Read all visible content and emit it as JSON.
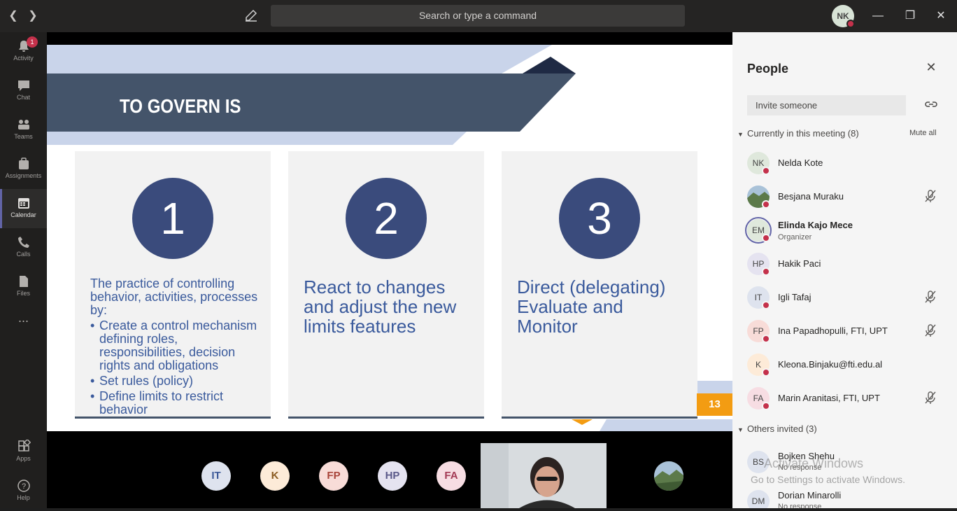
{
  "titlebar": {
    "search_placeholder": "Search or type a command",
    "me_initials": "NK"
  },
  "rail": {
    "activity_badge": "1",
    "items": [
      {
        "label": "Activity",
        "icon": "bell-icon"
      },
      {
        "label": "Chat",
        "icon": "chat-icon"
      },
      {
        "label": "Teams",
        "icon": "teams-icon"
      },
      {
        "label": "Assignments",
        "icon": "assignments-icon"
      },
      {
        "label": "Calendar",
        "icon": "calendar-icon",
        "active": true
      },
      {
        "label": "Calls",
        "icon": "phone-icon"
      },
      {
        "label": "Files",
        "icon": "file-icon"
      },
      {
        "label": "Apps",
        "icon": "apps-icon"
      },
      {
        "label": "Help",
        "icon": "help-icon"
      }
    ],
    "more": "..."
  },
  "slide": {
    "title": "TO GOVERN IS",
    "page_number": "13",
    "cards": [
      {
        "number": "1",
        "intro": "The practice of controlling behavior, activities, processes by:",
        "bullets": [
          "Create a control mechanism defining roles, responsibilities, decision rights and obligations",
          "Set rules (policy)",
          "Define limits to restrict behavior"
        ]
      },
      {
        "number": "2",
        "text": "React to changes and adjust the new limits features"
      },
      {
        "number": "3",
        "text": "Direct (delegating) Evaluate and Monitor"
      }
    ]
  },
  "call_strip": {
    "thumbs": [
      {
        "initials": "IT",
        "bg": "#dee3ee",
        "color": "#3b5998"
      },
      {
        "initials": "K",
        "bg": "#fdebd8",
        "color": "#8a5a20"
      },
      {
        "initials": "FP",
        "bg": "#f8dcd8",
        "color": "#a8443a"
      },
      {
        "initials": "HP",
        "bg": "#e5e3f0",
        "color": "#5b5a8a"
      },
      {
        "initials": "FA",
        "bg": "#f7dde3",
        "color": "#a33a55"
      }
    ]
  },
  "people": {
    "title": "People",
    "invite_placeholder": "Invite someone",
    "current_header": "Currently in this meeting (8)",
    "mute_all": "Mute all",
    "current": [
      {
        "initials": "NK",
        "name": "Nelda Kote",
        "bg": "#dfe8dc",
        "muted": false
      },
      {
        "initials": "",
        "name": "Besjana Muraku",
        "bg": "#6e8c5a",
        "muted": true,
        "photo": true
      },
      {
        "initials": "EM",
        "name": "Elinda Kajo Mece",
        "role": "Organizer",
        "bg": "#dfe8dc",
        "muted": false,
        "bold": true
      },
      {
        "initials": "HP",
        "name": "Hakik Paci",
        "bg": "#e5e3f0",
        "muted": false
      },
      {
        "initials": "IT",
        "name": "Igli Tafaj",
        "bg": "#dee3ee",
        "muted": true
      },
      {
        "initials": "FP",
        "name": "Ina Papadhopulli, FTI, UPT",
        "bg": "#f8dcd8",
        "muted": true
      },
      {
        "initials": "K",
        "name": "Kleona.Binjaku@fti.edu.al",
        "bg": "#fdebd8",
        "muted": false
      },
      {
        "initials": "FA",
        "name": "Marin Aranitasi, FTI, UPT",
        "bg": "#f7dde3",
        "muted": true
      }
    ],
    "invited_header": "Others invited (3)",
    "invited": [
      {
        "initials": "BS",
        "name": "Bojken Shehu",
        "status": "No response",
        "bg": "#dee3ee"
      },
      {
        "initials": "DM",
        "name": "Dorian Minarolli",
        "status": "No response",
        "bg": "#dee3ee"
      }
    ]
  },
  "watermark": {
    "line1": "Activate Windows",
    "line2": "Go to Settings to activate Windows."
  }
}
